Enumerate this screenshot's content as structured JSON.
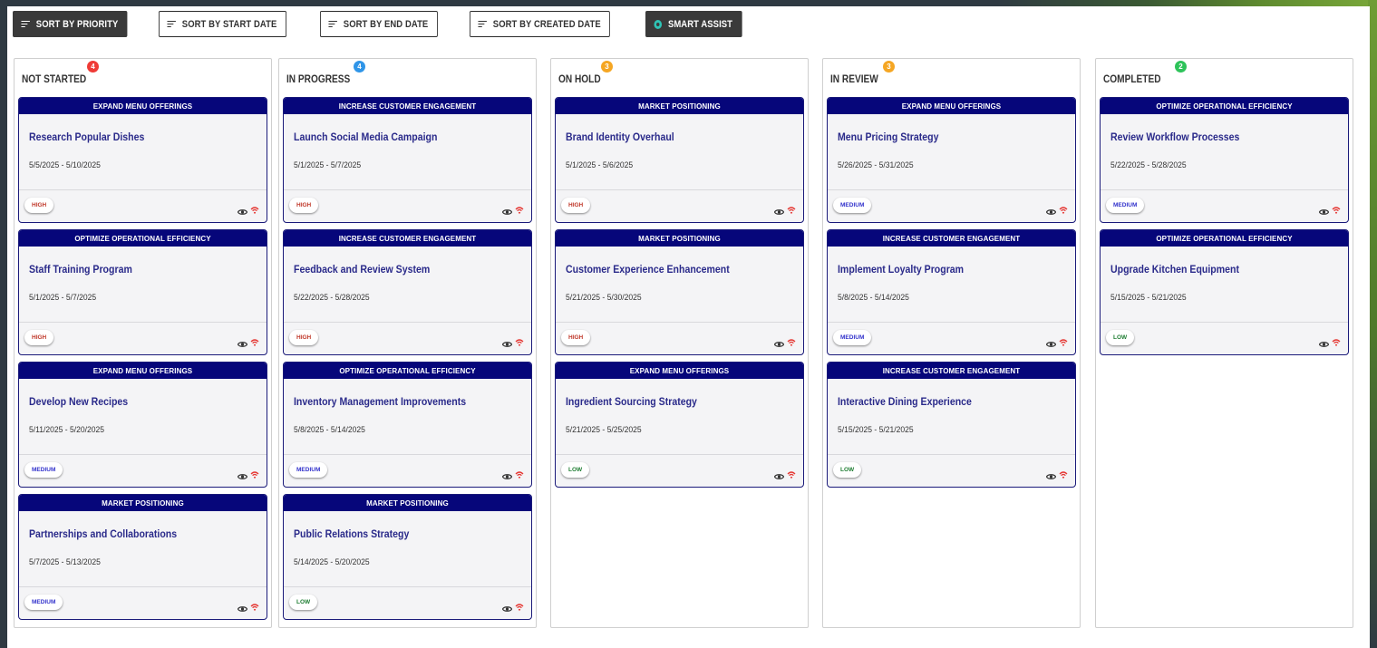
{
  "toolbar": {
    "buttons": [
      {
        "label": "SORT BY PRIORITY",
        "active": true
      },
      {
        "label": "SORT BY START DATE",
        "active": false
      },
      {
        "label": "SORT BY END DATE",
        "active": false
      },
      {
        "label": "SORT BY CREATED DATE",
        "active": false
      }
    ],
    "assist_label": "SMART ASSIST"
  },
  "colors": {
    "card_header": "#06067a",
    "badge_red": "#ef3b36",
    "badge_blue": "#2f95e8",
    "badge_orange": "#f5a623",
    "badge_green": "#2ec35a",
    "action_red": "#e53935"
  },
  "columns": [
    {
      "title": "NOT STARTED",
      "count": "4",
      "badge_color": "#ef3b36",
      "cards": [
        {
          "category": "EXPAND MENU OFFERINGS",
          "title": "Research Popular Dishes",
          "dates": "5/5/2025 - 5/10/2025",
          "priority": "HIGH"
        },
        {
          "category": "OPTIMIZE OPERATIONAL EFFICIENCY",
          "title": "Staff Training Program",
          "dates": "5/1/2025 - 5/7/2025",
          "priority": "HIGH"
        },
        {
          "category": "EXPAND MENU OFFERINGS",
          "title": "Develop New Recipes",
          "dates": "5/11/2025 - 5/20/2025",
          "priority": "MEDIUM"
        },
        {
          "category": "MARKET POSITIONING",
          "title": "Partnerships and Collaborations",
          "dates": "5/7/2025 - 5/13/2025",
          "priority": "MEDIUM"
        }
      ]
    },
    {
      "title": "IN PROGRESS",
      "count": "4",
      "badge_color": "#2f95e8",
      "cards": [
        {
          "category": "INCREASE CUSTOMER ENGAGEMENT",
          "title": "Launch Social Media Campaign",
          "dates": "5/1/2025 - 5/7/2025",
          "priority": "HIGH"
        },
        {
          "category": "INCREASE CUSTOMER ENGAGEMENT",
          "title": "Feedback and Review System",
          "dates": "5/22/2025 - 5/28/2025",
          "priority": "HIGH"
        },
        {
          "category": "OPTIMIZE OPERATIONAL EFFICIENCY",
          "title": "Inventory Management Improvements",
          "dates": "5/8/2025 - 5/14/2025",
          "priority": "MEDIUM"
        },
        {
          "category": "MARKET POSITIONING",
          "title": "Public Relations Strategy",
          "dates": "5/14/2025 - 5/20/2025",
          "priority": "LOW"
        }
      ]
    },
    {
      "title": "ON HOLD",
      "count": "3",
      "badge_color": "#f5a623",
      "cards": [
        {
          "category": "MARKET POSITIONING",
          "title": "Brand Identity Overhaul",
          "dates": "5/1/2025 - 5/6/2025",
          "priority": "HIGH"
        },
        {
          "category": "MARKET POSITIONING",
          "title": "Customer Experience Enhancement",
          "dates": "5/21/2025 - 5/30/2025",
          "priority": "HIGH"
        },
        {
          "category": "EXPAND MENU OFFERINGS",
          "title": "Ingredient Sourcing Strategy",
          "dates": "5/21/2025 - 5/25/2025",
          "priority": "LOW"
        }
      ]
    },
    {
      "title": "IN REVIEW",
      "count": "3",
      "badge_color": "#f5a623",
      "cards": [
        {
          "category": "EXPAND MENU OFFERINGS",
          "title": "Menu Pricing Strategy",
          "dates": "5/26/2025 - 5/31/2025",
          "priority": "MEDIUM"
        },
        {
          "category": "INCREASE CUSTOMER ENGAGEMENT",
          "title": "Implement Loyalty Program",
          "dates": "5/8/2025 - 5/14/2025",
          "priority": "MEDIUM"
        },
        {
          "category": "INCREASE CUSTOMER ENGAGEMENT",
          "title": "Interactive Dining Experience",
          "dates": "5/15/2025 - 5/21/2025",
          "priority": "LOW"
        }
      ]
    },
    {
      "title": "COMPLETED",
      "count": "2",
      "badge_color": "#2ec35a",
      "cards": [
        {
          "category": "OPTIMIZE OPERATIONAL EFFICIENCY",
          "title": "Review Workflow Processes",
          "dates": "5/22/2025 - 5/28/2025",
          "priority": "MEDIUM"
        },
        {
          "category": "OPTIMIZE OPERATIONAL EFFICIENCY",
          "title": "Upgrade Kitchen Equipment",
          "dates": "5/15/2025 - 5/21/2025",
          "priority": "LOW"
        }
      ]
    }
  ]
}
